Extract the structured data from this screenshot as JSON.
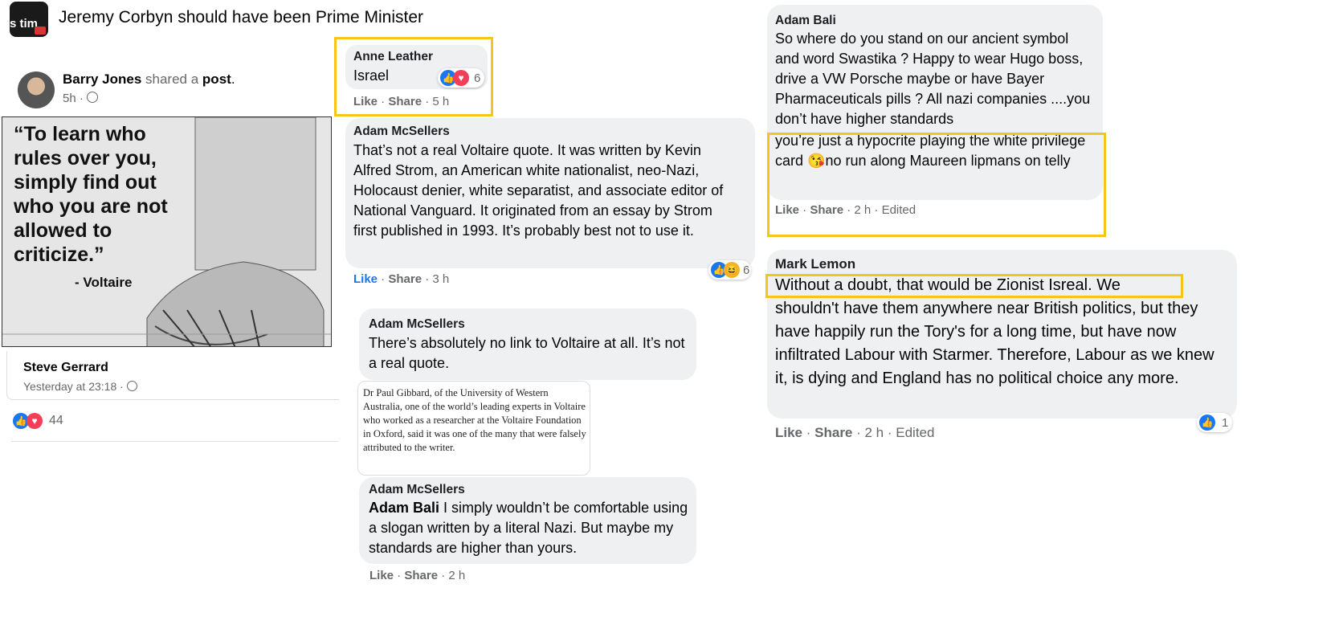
{
  "group": {
    "name": "Jeremy Corbyn should have been Prime Minister",
    "avatar_text": "s tim"
  },
  "post": {
    "author": "Barry Jones",
    "shared_text": "shared a",
    "post_word": "post",
    "time": "5h ·",
    "image_quote": "“To learn who rules over you, simply find out who you are not allowed to criticize.”",
    "image_attribution": "- Voltaire",
    "shared_from": "Steve Gerrard",
    "shared_time": "Yesterday at 23:18 ·",
    "reaction_count": "44"
  },
  "comments": {
    "anne": {
      "author": "Anne Leather",
      "text": "Israel",
      "reactions": "6",
      "like": "Like",
      "share": "Share",
      "time": "· 5 h"
    },
    "mcsellers1": {
      "author": "Adam McSellers",
      "text": "That’s not a real Voltaire quote. It was written by Kevin Alfred Strom, an American white nationalist, neo-Nazi, Holocaust denier, white separatist, and associate editor of National Vanguard. It originated from an essay by Strom first published in 1993. It’s probably best not to use it.",
      "reactions": "6",
      "like": "Like",
      "share": "Share",
      "time": "· 3 h"
    },
    "mcsellers2": {
      "author": "Adam McSellers",
      "text": "There’s absolutely no link to Voltaire at all. It’s not a real quote.",
      "clipping": "Dr Paul Gibbard, of the University of Western Australia, one of the world’s leading experts in Voltaire who worked as a researcher at the Voltaire Foundation in Oxford, said it was one of the many that were falsely attributed to the writer."
    },
    "mcsellers3": {
      "author": "Adam McSellers",
      "mention": "Adam Bali",
      "text": " I simply wouldn’t be comfortable using a slogan written by a literal Nazi. But maybe my standards are higher than yours.",
      "like": "Like",
      "share": "Share",
      "time": "· 2 h"
    },
    "bali": {
      "author": "Adam Bali",
      "text": "So where do you stand on our ancient symbol and word Swastika ? Happy to wear Hugo boss, drive a VW Porsche maybe or have Bayer Pharmaceuticals pills ? All nazi companies ....you don’t have higher standards",
      "text2a": "you’re just a hypocrite playing the white privilege card ",
      "emoji": "😘",
      "text2b": "no run along Maureen lipmans on telly",
      "like": "Like",
      "share": "Share",
      "time": "· 2 h · Edited"
    },
    "lemon": {
      "author": "Mark Lemon",
      "text_highlight": "Without a doubt, that would be Zionist Isreal. We",
      "text_rest": "shouldn't have them anywhere near British politics, but they have happily run the Tory's for a long time, but have now infiltrated Labour with Starmer. Therefore, Labour as we knew it, is dying and England has no political choice any more.",
      "reactions": "1",
      "like": "Like",
      "share": "Share",
      "time": "· 2 h · Edited"
    }
  },
  "colors": {
    "highlight": "#f5c518",
    "bubble": "#eff0f2",
    "like_blue": "#1877f2",
    "love_red": "#f33e58"
  },
  "icons": [
    "globe-icon",
    "like-icon",
    "love-icon",
    "haha-icon"
  ]
}
